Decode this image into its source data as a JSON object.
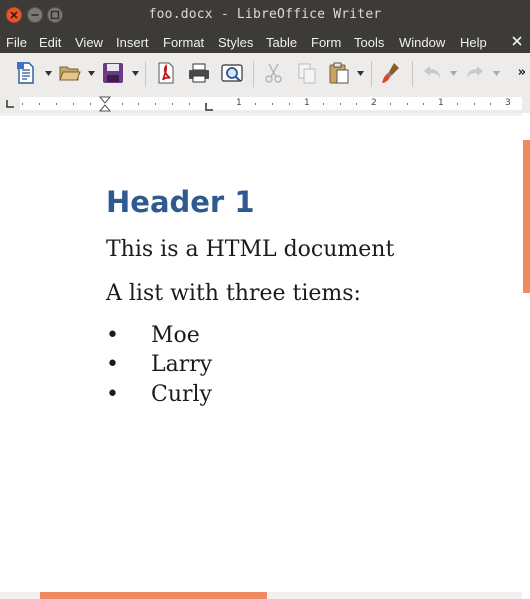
{
  "window": {
    "title": "foo.docx - LibreOffice Writer"
  },
  "menu": [
    "File",
    "Edit",
    "View",
    "Insert",
    "Format",
    "Styles",
    "Table",
    "Form",
    "Tools",
    "Window",
    "Help"
  ],
  "toolbar": {
    "icons": [
      "new-document-icon",
      "open-folder-icon",
      "save-icon",
      "export-pdf-icon",
      "print-icon",
      "print-preview-icon",
      "cut-icon",
      "copy-icon",
      "paste-icon",
      "clone-formatting-icon",
      "undo-icon",
      "redo-icon"
    ],
    "more": "»"
  },
  "ruler": {
    "numbers": [
      "1",
      "1",
      "1",
      "2",
      "1",
      "3"
    ]
  },
  "document": {
    "heading": "Header 1",
    "paragraph1": "This is a HTML document",
    "paragraph2": "A list with three tiems:",
    "list": [
      "Moe",
      "Larry",
      "Curly"
    ],
    "bullet": "•"
  },
  "colors": {
    "heading": "#2f5a8f",
    "accent": "#f08a63",
    "titlebar": "#3c3b37"
  }
}
